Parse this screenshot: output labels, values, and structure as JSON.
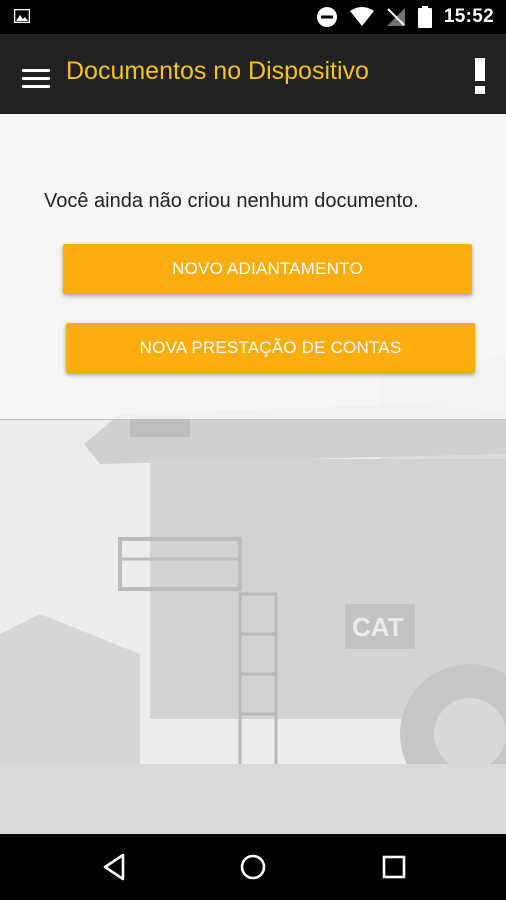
{
  "status_bar": {
    "time": "15:52",
    "icons": [
      "image-icon",
      "do-not-disturb-icon",
      "wifi-icon",
      "signal-off-icon",
      "battery-icon"
    ]
  },
  "app_bar": {
    "title": "Documentos no Dispositivo",
    "title_color": "#f7c21a",
    "background": "#222222",
    "menu_icon": "menu-icon",
    "action_icon": "alert-icon"
  },
  "main": {
    "empty_message": "Você ainda não criou nenhum documento.",
    "buttons": {
      "new_advance": "NOVO ADIANTAMENTO",
      "new_accounting": "NOVA PRESTAÇÃO DE CONTAS"
    },
    "accent_color": "#fbad0e",
    "background_art": "mining-truck-illustration",
    "truck_brand_text": "CAT"
  },
  "nav_bar": {
    "icons": [
      "back-icon",
      "home-icon",
      "recents-icon"
    ]
  }
}
